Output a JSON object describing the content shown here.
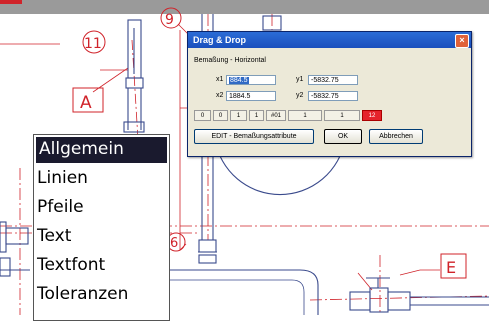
{
  "drawing": {
    "labels": [
      "11",
      "9",
      "A",
      "6",
      "E"
    ]
  },
  "dialog": {
    "title": "Drag & Drop",
    "subtitle": "Bemaßung - Horizontal",
    "fields": {
      "x1": {
        "label": "x1",
        "value": "884.5"
      },
      "y1": {
        "label": "y1",
        "value": "-5832.75"
      },
      "x2": {
        "label": "x2",
        "value": "1884.5"
      },
      "y2": {
        "label": "y2",
        "value": "-5832.75"
      }
    },
    "toolbar": [
      "0",
      "0",
      "1",
      "1",
      "#01",
      "1",
      "1",
      "12"
    ],
    "buttons": {
      "edit": "EDIT - Bemaßungsattribute",
      "ok": "OK",
      "cancel": "Abbrechen"
    },
    "close": "×"
  },
  "context_menu": {
    "items": [
      "Allgemein",
      "Linien",
      "Pfeile",
      "Text",
      "Textfont",
      "Toleranzen"
    ]
  },
  "colors": {
    "drawing_red": "#d0232a",
    "drawing_blue": "#3a4a8c"
  }
}
